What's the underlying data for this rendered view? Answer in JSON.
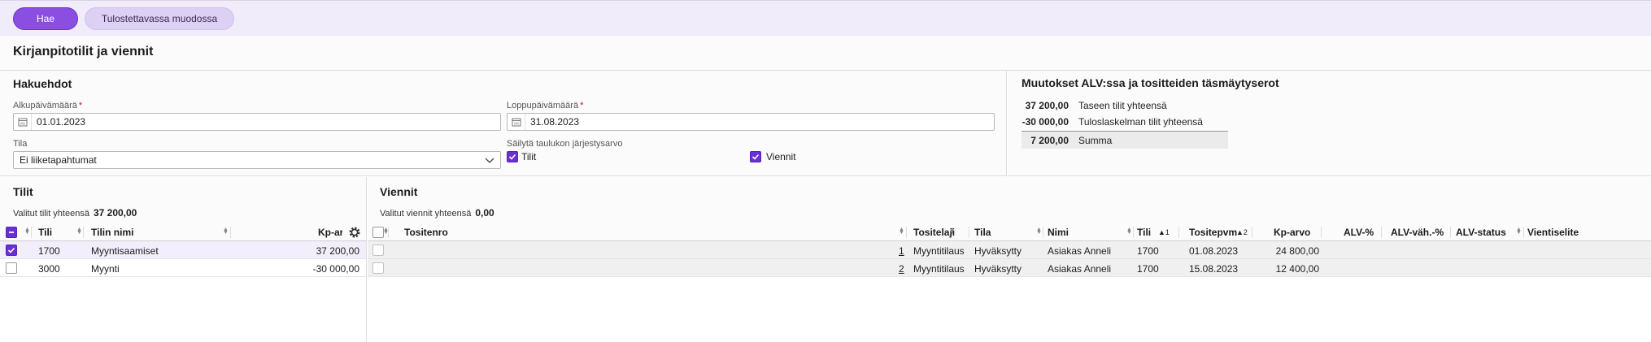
{
  "toolbar": {
    "search_label": "Hae",
    "print_label": "Tulostettavassa muodossa"
  },
  "page": {
    "title": "Kirjanpitotilit ja viennit"
  },
  "filters": {
    "title": "Hakuehdot",
    "start_date": {
      "label": "Alkupäivämäärä",
      "required": "*",
      "value": "01.01.2023"
    },
    "end_date": {
      "label": "Loppupäivämäärä",
      "required": "*",
      "value": "31.08.2023"
    },
    "status": {
      "label": "Tila",
      "value": "Ei liiketapahtumat"
    },
    "keep_sort": {
      "label": "Säilytä taulukon järjestysarvo",
      "accounts_label": "Tilit",
      "accounts_checked": true,
      "entries_label": "Viennit",
      "entries_checked": true
    }
  },
  "summary": {
    "title": "Muutokset ALV:ssa ja tositteiden täsmäytyserot",
    "rows": [
      {
        "amount": "37 200,00",
        "label": "Taseen tilit yhteensä"
      },
      {
        "amount": "-30 000,00",
        "label": "Tuloslaskelman tilit yhteensä"
      }
    ],
    "total": {
      "amount": "7 200,00",
      "label": "Summa"
    }
  },
  "accounts": {
    "title": "Tilit",
    "selected_total_label": "Valitut tilit yhteensä",
    "selected_total_value": "37 200,00",
    "columns": {
      "account": "Tili",
      "name": "Tilin nimi",
      "balance": "Kp-ar"
    },
    "rows": [
      {
        "checked": true,
        "account": "1700",
        "name": "Myyntisaamiset",
        "balance": "37 200,00"
      },
      {
        "checked": false,
        "account": "3000",
        "name": "Myynti",
        "balance": "-30 000,00"
      }
    ]
  },
  "entries": {
    "title": "Viennit",
    "selected_total_label": "Valitut viennit yhteensä",
    "selected_total_value": "0,00",
    "columns": {
      "voucher_no": "Tositenro",
      "voucher_type": "Tositelaji",
      "status": "Tila",
      "name": "Nimi",
      "account": "Tili",
      "account_sort": "1",
      "voucher_date": "Tositepvm",
      "voucher_date_sort": "2",
      "value": "Kp-arvo",
      "vat_pct": "ALV-%",
      "vat_ded_pct": "ALV-väh.-%",
      "vat_status": "ALV-status",
      "description": "Vientiselite"
    },
    "rows": [
      {
        "voucher_no": "1",
        "voucher_type": "Myyntitilaus",
        "status": "Hyväksytty",
        "name": "Asiakas Anneli",
        "account": "1700",
        "voucher_date": "01.08.2023",
        "value": "24 800,00"
      },
      {
        "voucher_no": "2",
        "voucher_type": "Myyntitilaus",
        "status": "Hyväksytty",
        "name": "Asiakas Anneli",
        "account": "1700",
        "voucher_date": "15.08.2023",
        "value": "12 400,00"
      }
    ]
  },
  "colors": {
    "accent": "#8a4fe0",
    "toolbar_bg": "#f1ecf9",
    "checkbox": "#6b2fd6"
  }
}
